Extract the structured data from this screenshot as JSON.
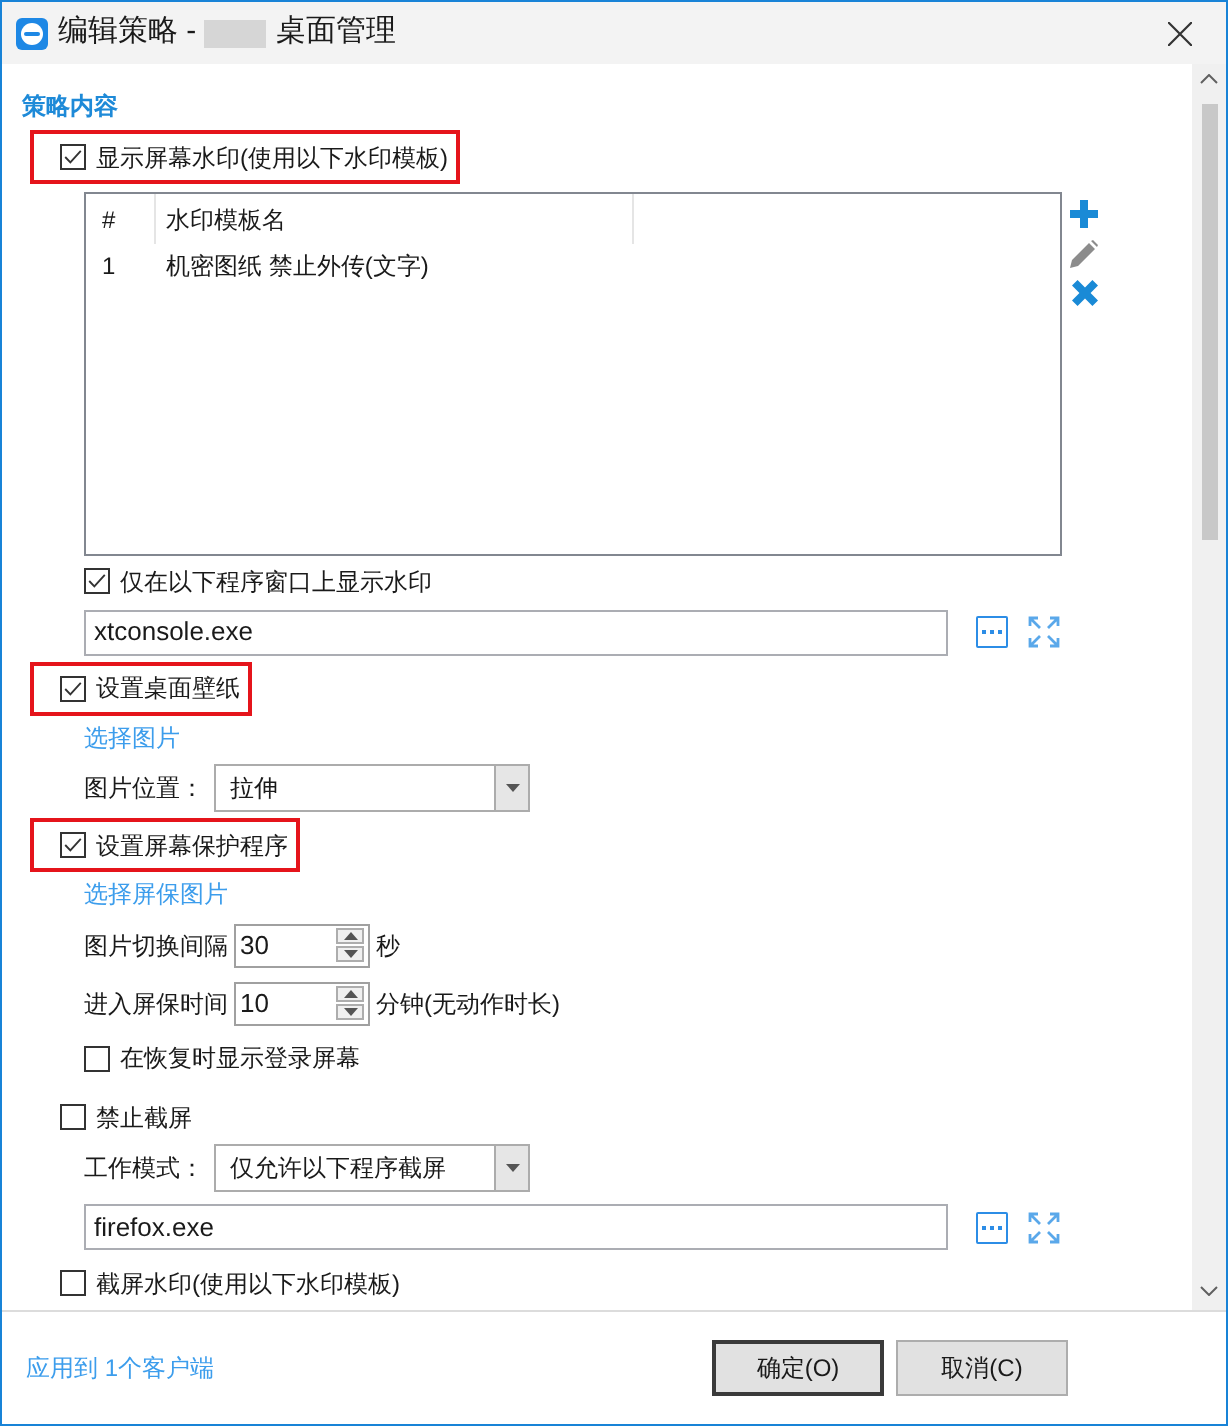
{
  "window": {
    "title_start": "编辑策略 -",
    "redacted": true,
    "title_end": "桌面管理"
  },
  "section_title": "策略内容",
  "sections": [
    {
      "label": "显示屏幕水印(使用以下水印模板)",
      "checked": true,
      "highlighted": true,
      "children": [
        {
          "kind": "table",
          "columns": [
            "#",
            "水印模板名"
          ],
          "rows": [
            [
              "1",
              "机密图纸 禁止外传(文字)"
            ]
          ],
          "tools": [
            {
              "kind": "add",
              "disabled": false
            },
            {
              "kind": "edit",
              "disabled": true
            },
            {
              "kind": "delete",
              "disabled": false
            }
          ]
        },
        {
          "kind": "checkbox",
          "label": "仅在以下程序窗口上显示水印",
          "checked": true
        },
        {
          "kind": "program_field",
          "value": "xtconsole.exe"
        }
      ]
    },
    {
      "label": "设置桌面壁纸",
      "checked": true,
      "highlighted": true,
      "children": [
        {
          "kind": "link",
          "label": "选择图片"
        },
        {
          "kind": "select",
          "label": "图片位置：",
          "value": "拉伸"
        }
      ]
    },
    {
      "label": "设置屏幕保护程序",
      "checked": true,
      "highlighted": true,
      "children": [
        {
          "kind": "link",
          "label": "选择屏保图片"
        },
        {
          "kind": "spinner",
          "label": "图片切换间隔",
          "value": "30",
          "unit": "秒"
        },
        {
          "kind": "spinner",
          "label": "进入屏保时间",
          "value": "10",
          "unit": "分钟(无动作时长)"
        },
        {
          "kind": "checkbox",
          "label": "在恢复时显示登录屏幕",
          "checked": false
        }
      ]
    },
    {
      "label": "禁止截屏",
      "checked": false,
      "highlighted": false,
      "children": [
        {
          "kind": "select",
          "label": "工作模式：",
          "value": "仅允许以下程序截屏"
        },
        {
          "kind": "program_field",
          "value": "firefox.exe"
        }
      ]
    },
    {
      "label": "截屏水印(使用以下水印模板)",
      "checked": false,
      "highlighted": false
    }
  ],
  "footer": {
    "apply_link": "应用到 1个客户端",
    "buttons": [
      {
        "label": "确定(O)",
        "default": true
      },
      {
        "label": "取消(C)",
        "default": false
      }
    ]
  }
}
